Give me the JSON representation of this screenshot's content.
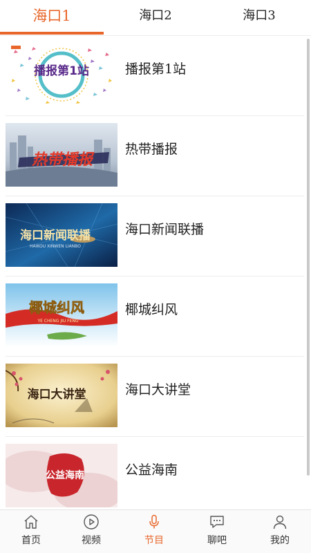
{
  "tabs": [
    {
      "label": "海口1",
      "active": true
    },
    {
      "label": "海口2",
      "active": false
    },
    {
      "label": "海口3",
      "active": false
    }
  ],
  "programs": [
    {
      "title": "播报第1站",
      "thumb_text": "播报第1站",
      "thumb_icon": "broadcast-station-1-thumbnail"
    },
    {
      "title": "热带播报",
      "thumb_text": "热带播报",
      "thumb_icon": "tropical-broadcast-thumbnail"
    },
    {
      "title": "海口新闻联播",
      "thumb_text": "海口新闻联播",
      "thumb_subtext": "HAIKOU XINWEN LIANBO",
      "thumb_icon": "haikou-news-thumbnail"
    },
    {
      "title": "椰城纠风",
      "thumb_text": "椰城纠风",
      "thumb_subtext": "YE CHENG JIU FENG",
      "thumb_icon": "yecheng-jiufeng-thumbnail"
    },
    {
      "title": "海口大讲堂",
      "thumb_text": "海口大讲堂",
      "thumb_icon": "haikou-lecture-thumbnail"
    },
    {
      "title": "公益海南",
      "thumb_text": "公益海南",
      "thumb_icon": "public-welfare-hainan-thumbnail"
    }
  ],
  "bottom_nav": [
    {
      "label": "首页",
      "icon": "home-icon",
      "active": false
    },
    {
      "label": "视频",
      "icon": "play-icon",
      "active": false
    },
    {
      "label": "节目",
      "icon": "microphone-icon",
      "active": true
    },
    {
      "label": "聊吧",
      "icon": "chat-icon",
      "active": false
    },
    {
      "label": "我的",
      "icon": "person-icon",
      "active": false
    }
  ],
  "colors": {
    "accent": "#e8662a",
    "text": "#222222",
    "divider": "#ececec"
  }
}
